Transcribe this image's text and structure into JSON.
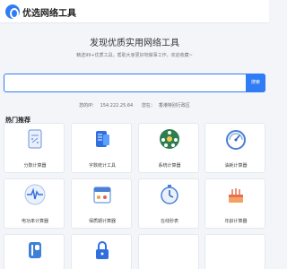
{
  "header": {
    "brand": "优选网络工具"
  },
  "hero": {
    "title": "发现优质实用网络工具",
    "subtitle": "精选99+优质工具，帮助大家更好地做事工作，欢迎收藏~"
  },
  "search": {
    "value": "",
    "placeholder": "",
    "button_label": "搜索"
  },
  "ipinfo": {
    "ip_label": "您的IP：",
    "ip_value": "154.222.25.64",
    "location_label": "您在：",
    "location_value": "香港特别行政区"
  },
  "section": {
    "title": "热门推荐"
  },
  "tools": [
    {
      "label": "分数计算器",
      "icon": "fraction-calculator-icon"
    },
    {
      "label": "字数统计工具",
      "icon": "word-count-icon"
    },
    {
      "label": "系统计算器",
      "icon": "people-network-icon"
    },
    {
      "label": "油耗计算器",
      "icon": "gauge-icon"
    },
    {
      "label": "电功率计算器",
      "icon": "heartbeat-icon"
    },
    {
      "label": "保质期计算器",
      "icon": "calendar-icon"
    },
    {
      "label": "在线秒表",
      "icon": "stopwatch-icon"
    },
    {
      "label": "年龄计算器",
      "icon": "birthday-cake-icon"
    },
    {
      "label": "",
      "icon": "parking-icon"
    },
    {
      "label": "",
      "icon": "lock-icon"
    }
  ],
  "colors": {
    "accent": "#2f7cf6",
    "background": "#f3f5f9"
  }
}
